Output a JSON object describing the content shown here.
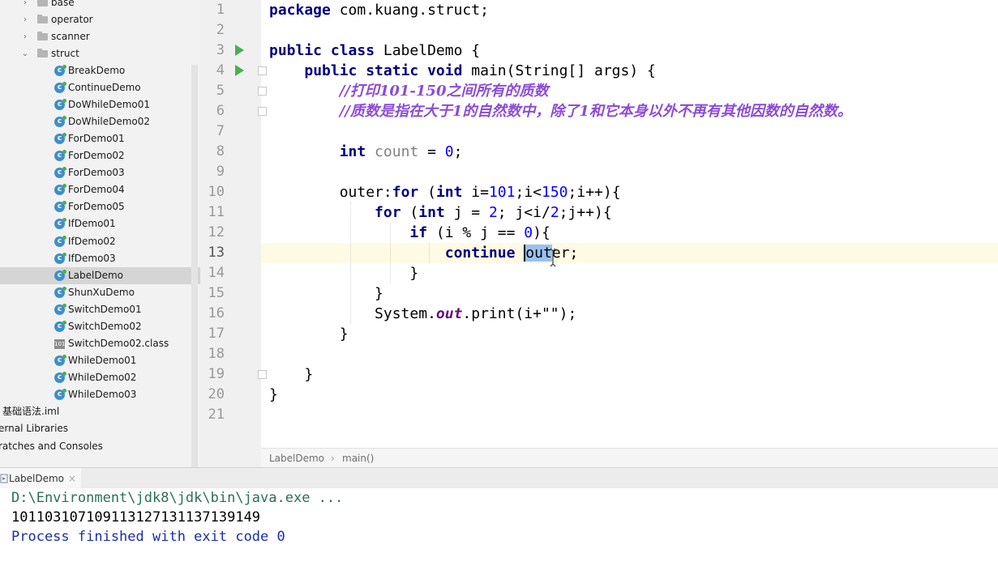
{
  "project_tree": {
    "items": [
      {
        "label": "base",
        "kind": "folder",
        "expanded": false
      },
      {
        "label": "operator",
        "kind": "folder",
        "expanded": false
      },
      {
        "label": "scanner",
        "kind": "folder",
        "expanded": false
      },
      {
        "label": "struct",
        "kind": "folder",
        "expanded": true
      },
      {
        "label": "BreakDemo",
        "kind": "class"
      },
      {
        "label": "ContinueDemo",
        "kind": "class"
      },
      {
        "label": "DoWhileDemo01",
        "kind": "class"
      },
      {
        "label": "DoWhileDemo02",
        "kind": "class"
      },
      {
        "label": "ForDemo01",
        "kind": "class"
      },
      {
        "label": "ForDemo02",
        "kind": "class"
      },
      {
        "label": "ForDemo03",
        "kind": "class"
      },
      {
        "label": "ForDemo04",
        "kind": "class"
      },
      {
        "label": "ForDemo05",
        "kind": "class"
      },
      {
        "label": "IfDemo01",
        "kind": "class"
      },
      {
        "label": "IfDemo02",
        "kind": "class"
      },
      {
        "label": "IfDemo03",
        "kind": "class"
      },
      {
        "label": "LabelDemo",
        "kind": "class",
        "selected": true
      },
      {
        "label": "ShunXuDemo",
        "kind": "class"
      },
      {
        "label": "SwitchDemo01",
        "kind": "class"
      },
      {
        "label": "SwitchDemo02",
        "kind": "class"
      },
      {
        "label": "SwitchDemo02.class",
        "kind": "binary"
      },
      {
        "label": "WhileDemo01",
        "kind": "class"
      },
      {
        "label": "WhileDemo02",
        "kind": "class"
      },
      {
        "label": "WhileDemo03",
        "kind": "class"
      },
      {
        "label": "基础语法.iml",
        "kind": "file"
      },
      {
        "label": "ernal Libraries",
        "kind": "root"
      },
      {
        "label": "ratches and Consoles",
        "kind": "root"
      }
    ]
  },
  "editor": {
    "line_numbers": [
      "1",
      "2",
      "3",
      "4",
      "5",
      "6",
      "7",
      "8",
      "9",
      "10",
      "11",
      "12",
      "13",
      "14",
      "15",
      "16",
      "17",
      "18",
      "19",
      "20",
      "21"
    ],
    "current_line": "13",
    "code": {
      "l1_kw": "package",
      "l1_rest": " com.kuang.struct;",
      "l3_kw": "public class",
      "l3_rest": " LabelDemo {",
      "l4_kw": "public static void",
      "l4_rest": " main(String[] args) {",
      "l5_comment": "//打印101-150之间所有的质数",
      "l6_comment": "//质数是指在大于1的自然数中，除了1和它本身以外不再有其他因数的自然数。",
      "l8_kw": "int",
      "l8_var": " count",
      "l8_eq": " = ",
      "l8_num": "0",
      "l8_end": ";",
      "l10_label": "outer:",
      "l10_for": "for",
      "l10_a": " (",
      "l10_int": "int",
      "l10_b": " i=",
      "l10_n1": "101",
      "l10_c": ";i<",
      "l10_n2": "150",
      "l10_d": ";i++){",
      "l11_for": "for",
      "l11_a": " (",
      "l11_int": "int",
      "l11_b": " j = ",
      "l11_n1": "2",
      "l11_c": "; j<i/",
      "l11_n2": "2",
      "l11_d": ";j++){",
      "l12_if": "if",
      "l12_a": " (i % j == ",
      "l12_n": "0",
      "l12_b": "){",
      "l13_kw": "continue",
      "l13_sp": " ",
      "l13_sel": "out",
      "l13_rest": "er;",
      "l14": "}",
      "l15": "}",
      "l16_a": "System.",
      "l16_out": "out",
      "l16_b": ".print(i+\"\");",
      "l17": "}",
      "l19": "}",
      "l20": "}"
    }
  },
  "breadcrumb": {
    "class_name": "LabelDemo",
    "method": "main()"
  },
  "run_panel": {
    "tab_label": "LabelDemo",
    "close_glyph": "×",
    "lines": [
      "D:\\Environment\\jdk8\\jdk\\bin\\java.exe ...",
      "101103107109113127131137139149",
      "Process finished with exit code 0"
    ]
  },
  "colors": {
    "keyword": "#000080",
    "number": "#0000ff",
    "comment": "#8c4cd6",
    "static_field": "#660e7a",
    "console_command": "#2c6e57",
    "console_exit": "#1a2fa6",
    "run_gutter": "#4caf50"
  }
}
